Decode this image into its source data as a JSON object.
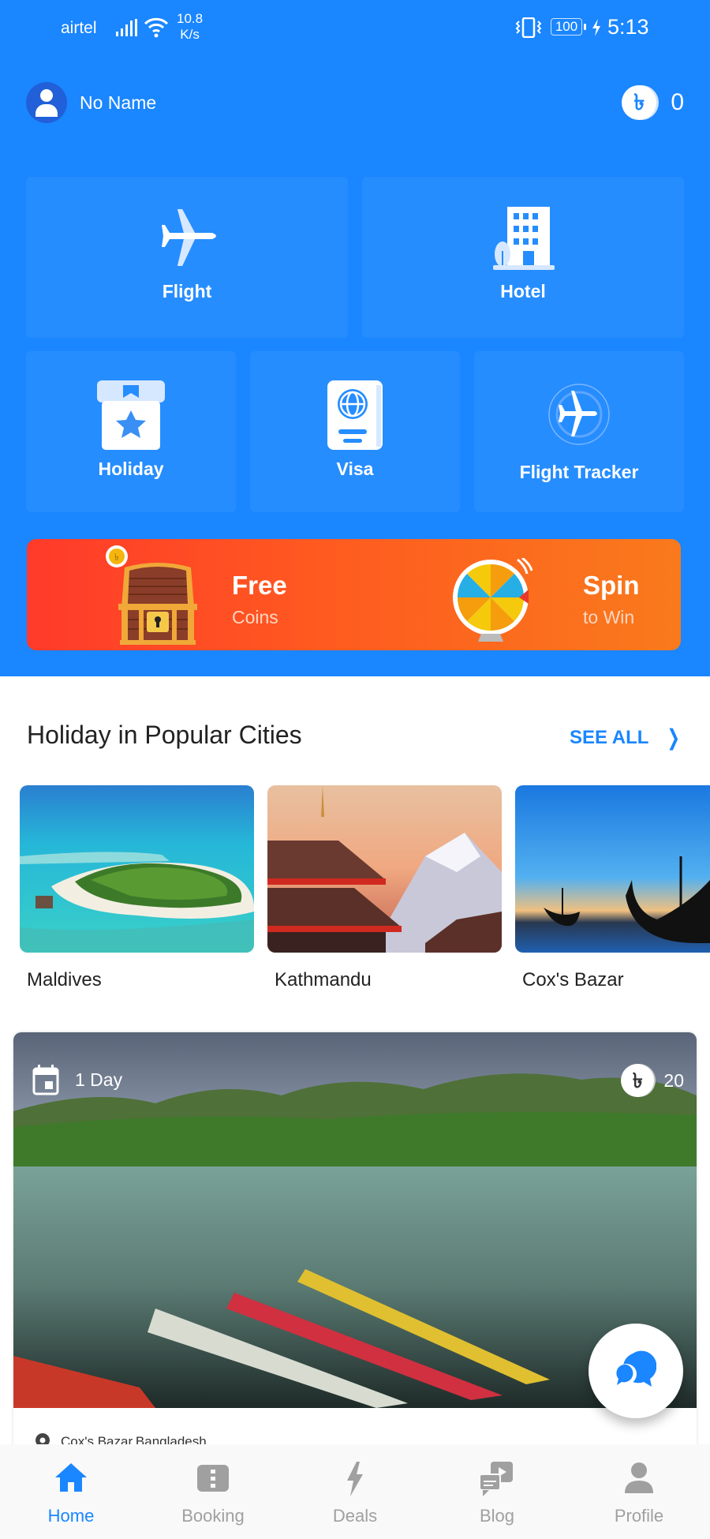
{
  "status_bar": {
    "carrier": "airtel",
    "speed_value": "10.8",
    "speed_unit": "K/s",
    "battery": "100",
    "time": "5:13"
  },
  "user": {
    "name": "No Name",
    "coin_symbol": "৳",
    "coin_balance": "0"
  },
  "services": [
    {
      "label": "Flight",
      "icon": "airplane-icon"
    },
    {
      "label": "Hotel",
      "icon": "hotel-building-icon"
    },
    {
      "label": "Holiday",
      "icon": "holiday-ticket-icon"
    },
    {
      "label": "Visa",
      "icon": "passport-icon"
    },
    {
      "label": "Flight Tracker",
      "icon": "flight-tracker-icon"
    }
  ],
  "promo_banner": {
    "left_title": "Free",
    "left_subtitle": "Coins",
    "right_title": "Spin",
    "right_subtitle": "to Win"
  },
  "popular_cities": {
    "title": "Holiday in Popular Cities",
    "see_all": "SEE ALL",
    "cities": [
      {
        "name": "Maldives"
      },
      {
        "name": "Kathmandu"
      },
      {
        "name": "Cox's Bazar"
      }
    ]
  },
  "package_card": {
    "duration": "1 Day",
    "price": "20",
    "coin_symbol": "৳",
    "location": "Cox's Bazar,Bangladesh"
  },
  "bottom_nav": [
    {
      "label": "Home",
      "active": true
    },
    {
      "label": "Booking"
    },
    {
      "label": "Deals"
    },
    {
      "label": "Blog"
    },
    {
      "label": "Profile"
    }
  ],
  "colors": {
    "primary": "#1a86ff",
    "tile": "#268dff",
    "banner_start": "#ff3a2a",
    "banner_end": "#f97a1c",
    "inactive": "#a0a0a0"
  }
}
